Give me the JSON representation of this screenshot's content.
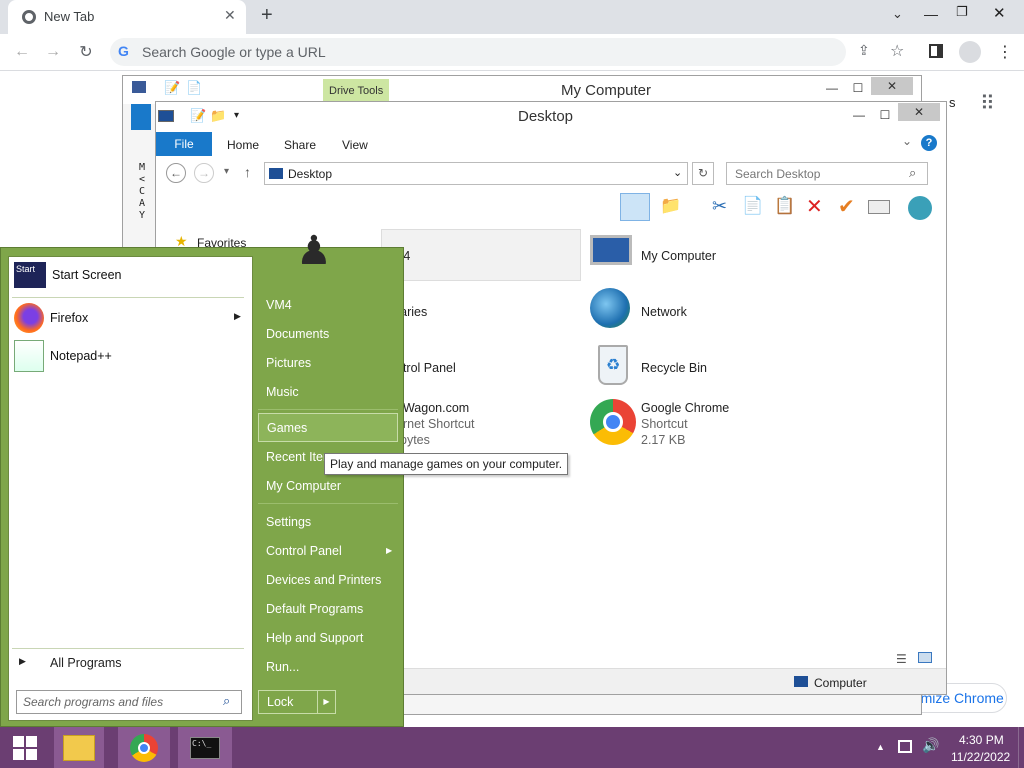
{
  "browser": {
    "tab_title": "New Tab",
    "omnibox_placeholder": "Search Google or type a URL",
    "customize_label": "Customize Chrome"
  },
  "back_window": {
    "title": "My Computer",
    "ribbon_tab": "Drive Tools",
    "side_letters": "M<CAY"
  },
  "front_window": {
    "title": "Desktop",
    "tabs": [
      "File",
      "Home",
      "Share",
      "View"
    ],
    "address": "Desktop",
    "search_placeholder": "Search Desktop",
    "status": "Computer"
  },
  "sidebar": {
    "favorites": "Favorites"
  },
  "items": [
    {
      "label": "VM4",
      "partial": "M4"
    },
    {
      "label": "Libraries",
      "partial": "raries"
    },
    {
      "label": "Control Panel",
      "partial": "ntrol Panel"
    },
    {
      "label": "DataWagon.com",
      "partial": "aWagon.com",
      "sub1": "ernet Shortcut",
      "sub2": "bytes"
    },
    {
      "label": "My Computer"
    },
    {
      "label": "Network"
    },
    {
      "label": "Recycle Bin"
    },
    {
      "label": "Google Chrome",
      "sub1": "Shortcut",
      "sub2": "2.17 KB"
    }
  ],
  "start_menu": {
    "pinned": [
      {
        "label": "Start Screen",
        "icon_text": "Start"
      },
      {
        "label": "Firefox"
      },
      {
        "label": "Notepad++"
      }
    ],
    "all_programs": "All Programs",
    "search_placeholder": "Search programs and files",
    "right": [
      "VM4",
      "Documents",
      "Pictures",
      "Music",
      "Games",
      "Recent Items",
      "My Computer",
      "Settings",
      "Control Panel",
      "Devices and Printers",
      "Default Programs",
      "Help and Support",
      "Run..."
    ],
    "lock": "Lock",
    "tooltip": "Play and manage games on your computer."
  },
  "taskbar": {
    "time": "4:30 PM",
    "date": "11/22/2022"
  },
  "colors": {
    "startmenu": "#7fa64a",
    "taskbar": "#6b3e72",
    "accent": "#1979ca"
  }
}
